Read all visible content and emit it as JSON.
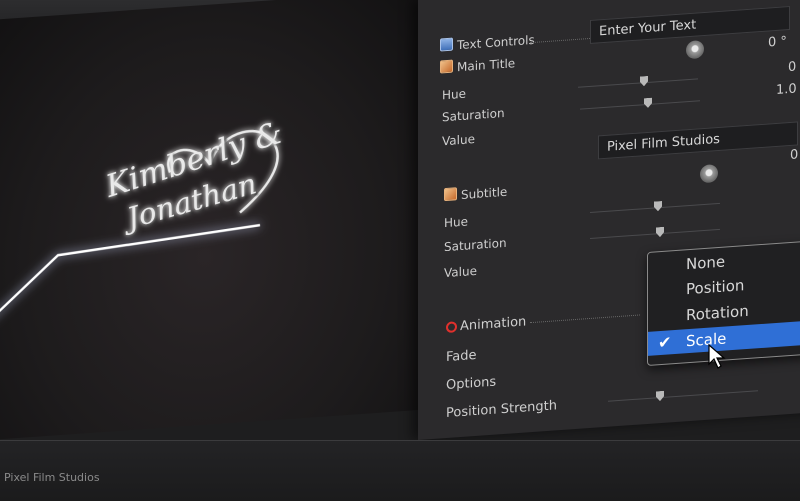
{
  "viewer": {
    "title_line1": "Kimberly &",
    "title_line2": "Jonathan"
  },
  "inspector": {
    "text_controls_label": "Text Controls",
    "text_controls_placeholder": "Enter Your Text",
    "main_title": {
      "label": "Main Title",
      "angle_value": "0 °",
      "hue_label": "Hue",
      "hue_value": "0",
      "saturation_label": "Saturation",
      "saturation_value": "1.0",
      "value_label": "Value"
    },
    "subtitle": {
      "field_value": "Pixel Film Studios",
      "label": "Subtitle",
      "angle_value": "0",
      "hue_label": "Hue",
      "saturation_label": "Saturation",
      "value_label": "Value"
    },
    "animation": {
      "label": "Animation",
      "fade_label": "Fade",
      "options_label": "Options",
      "position_strength_label": "Position Strength"
    }
  },
  "dropdown": {
    "options": [
      "None",
      "Position",
      "Rotation",
      "Scale"
    ],
    "selected": "Scale",
    "checkmark": "✔"
  },
  "footer": {
    "brand": "Pixel Film Studios"
  },
  "colors": {
    "selection": "#2f6fd6",
    "animation_ring": "#e0302c"
  }
}
